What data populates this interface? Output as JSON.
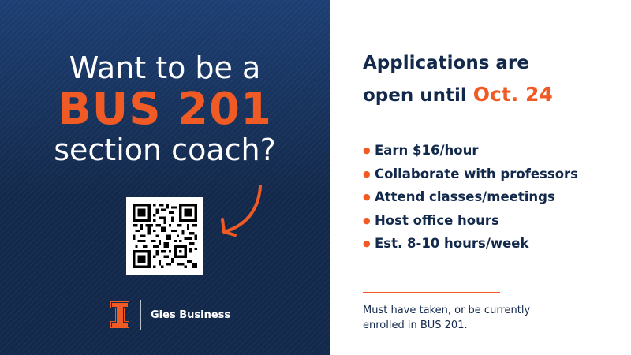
{
  "colors": {
    "navy": "#13294b",
    "orange": "#f05a24",
    "white": "#ffffff"
  },
  "left": {
    "headline_top": "Want to be a",
    "headline_main": "BUS 201",
    "headline_bottom": "section coach?",
    "qr_icon": "qr-code-icon",
    "arrow_icon": "curved-arrow-icon",
    "logo_icon": "block-i-logo-icon",
    "logo_text": "Gies Business"
  },
  "right": {
    "heading_line1": "Applications are",
    "heading_line2_prefix": "open until",
    "deadline": "Oct. 24",
    "bullets": [
      "Earn $16/hour",
      "Collaborate with professors",
      "Attend classes/meetings",
      "Host office hours",
      "Est. 8-10 hours/week"
    ],
    "note_line1": "Must have taken, or be currently",
    "note_line2": "enrolled in BUS 201."
  }
}
